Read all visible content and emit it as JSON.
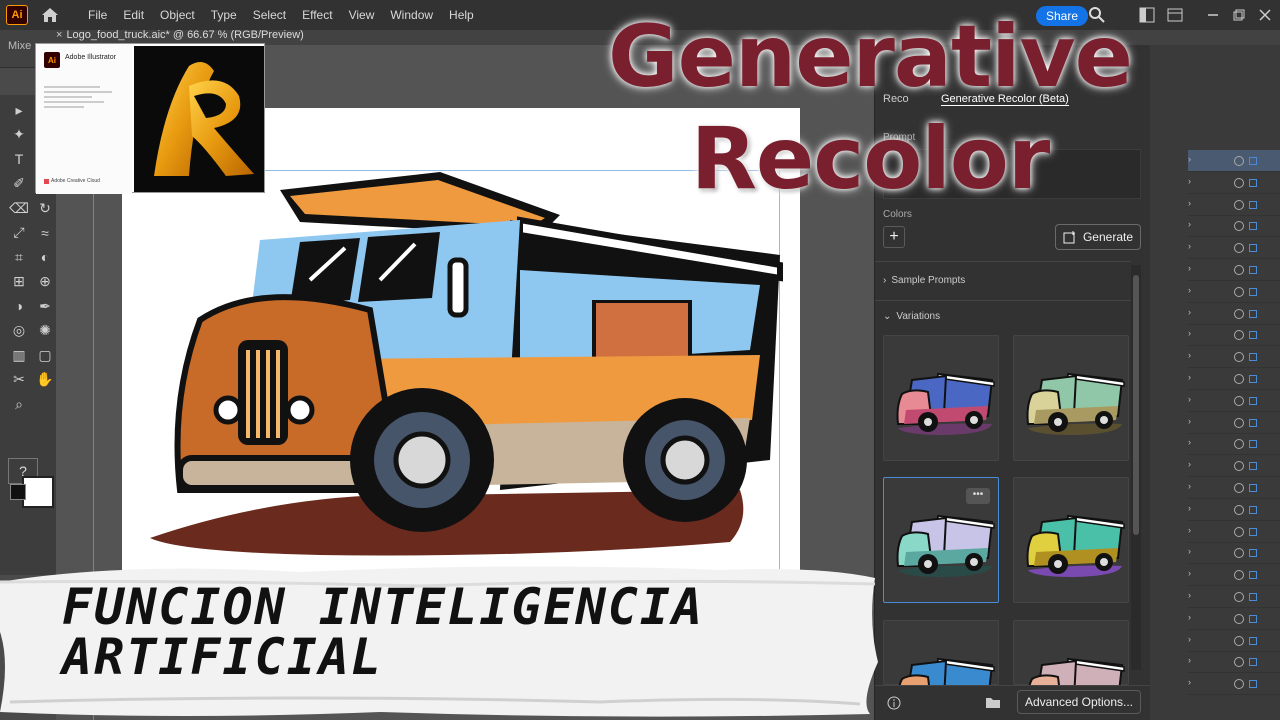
{
  "app": {
    "logo_text": "Ai"
  },
  "menu": {
    "items": [
      "File",
      "Edit",
      "Object",
      "Type",
      "Select",
      "Effect",
      "View",
      "Window",
      "Help"
    ],
    "share_label": "Share"
  },
  "controlbar": {
    "mixed_label": "Mixe"
  },
  "document": {
    "tab_title": "Logo_food_truck.aic* @ 66.67 % (RGB/Preview)",
    "close_glyph": "×"
  },
  "splash": {
    "logo_text": "Ai",
    "title": "Adobe Illustrator",
    "cc_label": "Adobe Creative Cloud"
  },
  "recolor_panel": {
    "tab_prefix": "Reco",
    "tab_selected": "Generative Recolor (Beta)",
    "prompt_label": "Prompt",
    "colors_label": "Colors",
    "plus_glyph": "+",
    "generate_label": "Generate",
    "sample_prompts_label": "Sample Prompts",
    "variations_label": "Variations",
    "more_glyph": "•••",
    "advanced_label": "Advanced Options...",
    "variation_palettes": [
      {
        "body": "#e88a94",
        "top": "#4a67c4",
        "accent": "#c04a70",
        "shadow": "#6a3a6a"
      },
      {
        "body": "#d9d39a",
        "top": "#8fc7a8",
        "accent": "#a89a60",
        "shadow": "#5a5030"
      },
      {
        "body": "#8ad8c8",
        "top": "#c8c4e8",
        "accent": "#5aa8a0",
        "shadow": "#2a4a48"
      },
      {
        "body": "#e0d040",
        "top": "#4ac0a8",
        "accent": "#b09020",
        "shadow": "#7a4ab0"
      },
      {
        "body": "#e8a070",
        "top": "#3a8ad0",
        "accent": "#c07040",
        "shadow": "#5a3a30"
      },
      {
        "body": "#e8b098",
        "top": "#d0b0b8",
        "accent": "#c08070",
        "shadow": "#6a4040"
      }
    ]
  },
  "overlay": {
    "title_line1": "Generative",
    "title_line2": "Recolor",
    "banner_line1": "FUNCION INTELIGENCIA",
    "banner_line2": "ARTIFICIAL"
  },
  "truck_colors": {
    "cab_blue": "#8ec8f0",
    "body_orange": "#f09a40",
    "dark_orange": "#c86a28",
    "beige": "#c8b49a",
    "shadow": "#6a2a1e",
    "panel_orange": "#d07040"
  },
  "tools": [
    "selection-tool",
    "direct-selection-tool",
    "magic-wand-tool",
    "pen-tool",
    "type-tool",
    "rectangle-tool",
    "paintbrush-tool",
    "shaper-tool",
    "eraser-tool",
    "rotate-tool",
    "scale-tool",
    "width-tool",
    "free-transform-tool",
    "shape-builder-tool",
    "perspective-tool",
    "mesh-tool",
    "gradient-tool",
    "eyedropper-tool",
    "blend-tool",
    "symbol-sprayer-tool",
    "graph-tool",
    "artboard-tool",
    "slice-tool",
    "hand-tool",
    "zoom-tool"
  ],
  "help_glyph": "?"
}
